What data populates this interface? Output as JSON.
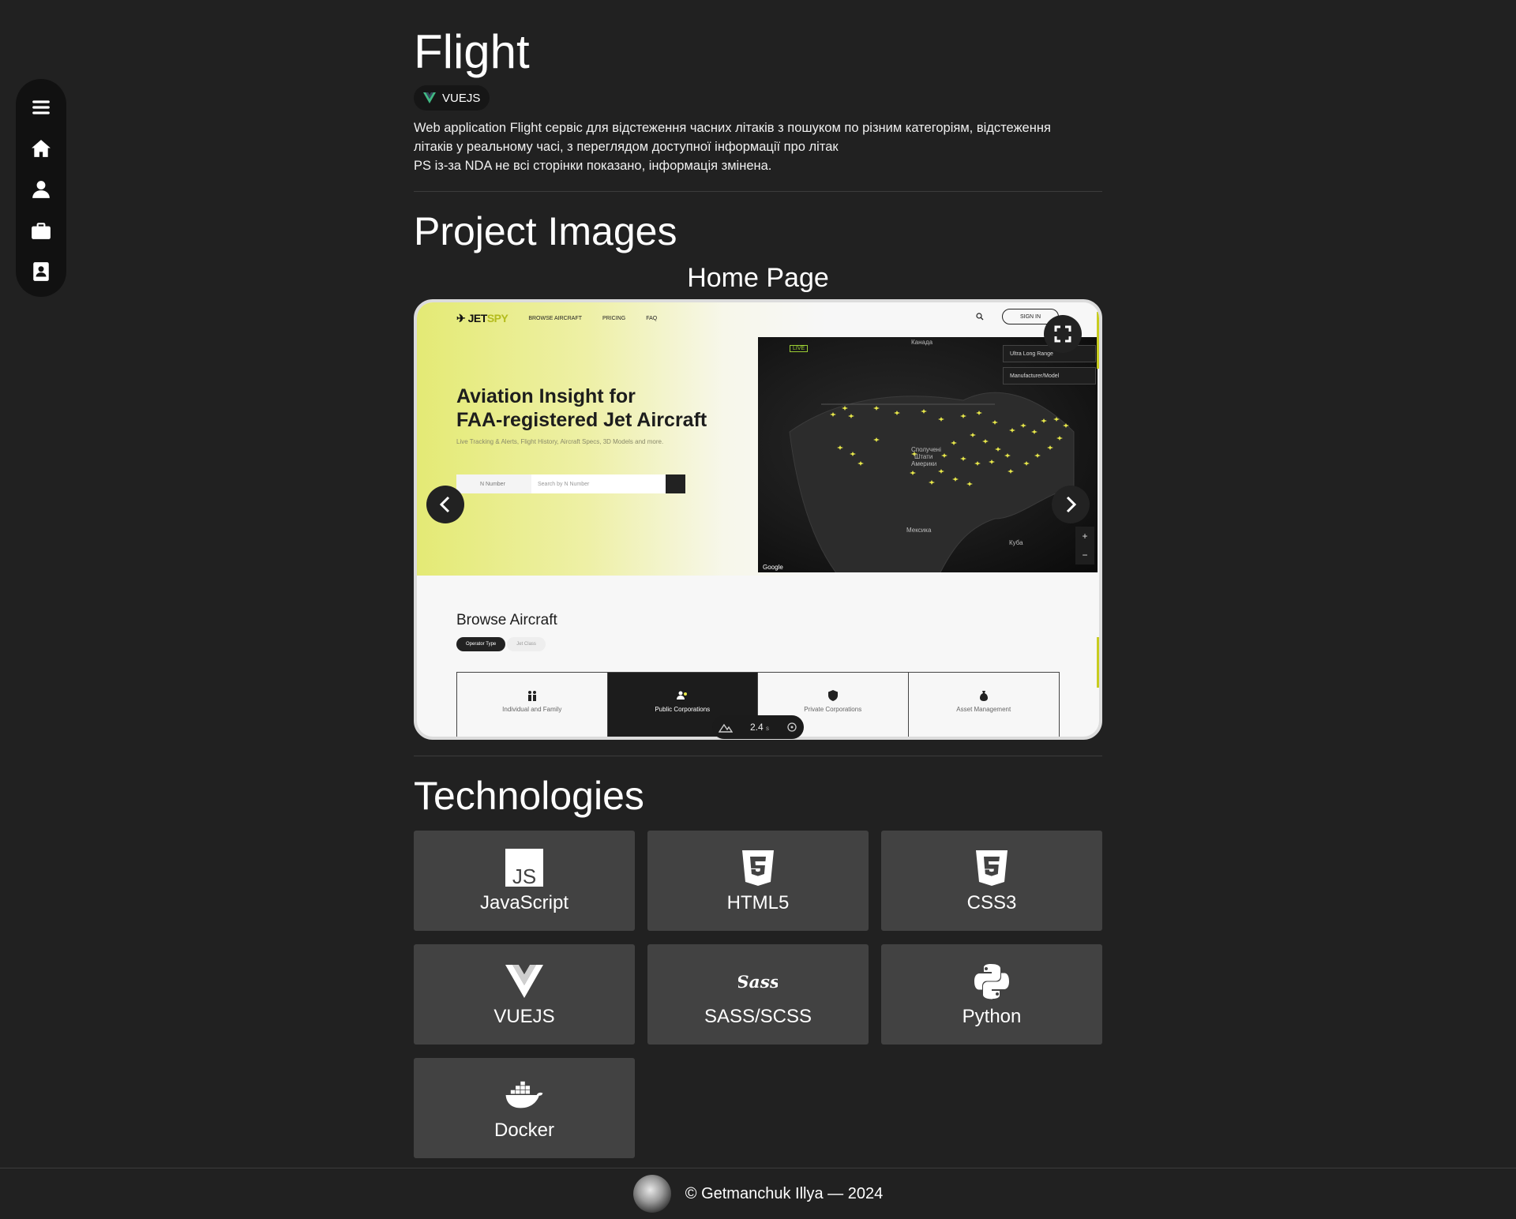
{
  "sidebar": {
    "items": [
      {
        "icon": "menu-icon"
      },
      {
        "icon": "home-icon"
      },
      {
        "icon": "user-icon"
      },
      {
        "icon": "briefcase-icon"
      },
      {
        "icon": "contact-icon"
      }
    ]
  },
  "project": {
    "title": "Flight",
    "badge": "VUEJS",
    "description": [
      "Web application Flight сервіс для відстеження часних літаків з пошуком по різним категоріям, відстеження",
      "літаків у реальному часі, з переглядом доступної інформації про літак",
      "PS із-за NDA не всі сторінки показано, інформація змінена."
    ]
  },
  "images_section": {
    "heading": "Project Images",
    "current_title": "Home Page",
    "speed_value": "2.4",
    "speed_unit": "s"
  },
  "screenshot": {
    "logo_a": "JET",
    "logo_b": "SPY",
    "nav": [
      "BROWSE AIRCRAFT",
      "PRICING",
      "FAQ"
    ],
    "signin": "SIGN IN",
    "hero_line1": "Aviation Insight for",
    "hero_line2": "FAA-registered Jet Aircraft",
    "hero_sub": "Live Tracking & Alerts, Flight History, Aircraft Specs, 3D Models and more.",
    "search_select": "N Number",
    "search_placeholder": "Search by N Number",
    "map_live": "LIVE",
    "map_dd1": "Ultra Long Range",
    "map_dd2": "Manufacturer/Model",
    "map_labels": {
      "canada": "Канада",
      "usa1": "Сполучені",
      "usa2": "Штати",
      "usa3": "Америки",
      "mexico": "Мексика",
      "cuba": "Куба"
    },
    "map_google": "Google",
    "browse_heading": "Browse Aircraft",
    "pill_on": "Operator Type",
    "pill_off": "Jet Class",
    "categories": [
      "Individual and Family",
      "Public Corporations",
      "Private Corporations",
      "Asset Management"
    ]
  },
  "technologies": {
    "heading": "Technologies",
    "items": [
      {
        "name": "JavaScript",
        "icon": "javascript-icon"
      },
      {
        "name": "HTML5",
        "icon": "html5-icon"
      },
      {
        "name": "CSS3",
        "icon": "css3-icon"
      },
      {
        "name": "VUEJS",
        "icon": "vue-icon"
      },
      {
        "name": "SASS/SCSS",
        "icon": "sass-icon"
      },
      {
        "name": "Python",
        "icon": "python-icon"
      },
      {
        "name": "Docker",
        "icon": "docker-icon"
      }
    ]
  },
  "footer": {
    "copyright": "© Getmanchuk Illya — 2024"
  },
  "colors": {
    "background": "#212121",
    "card": "#424242",
    "sidebar": "#111111",
    "accent": "#c8cc20",
    "vue_green": "#41b883"
  }
}
